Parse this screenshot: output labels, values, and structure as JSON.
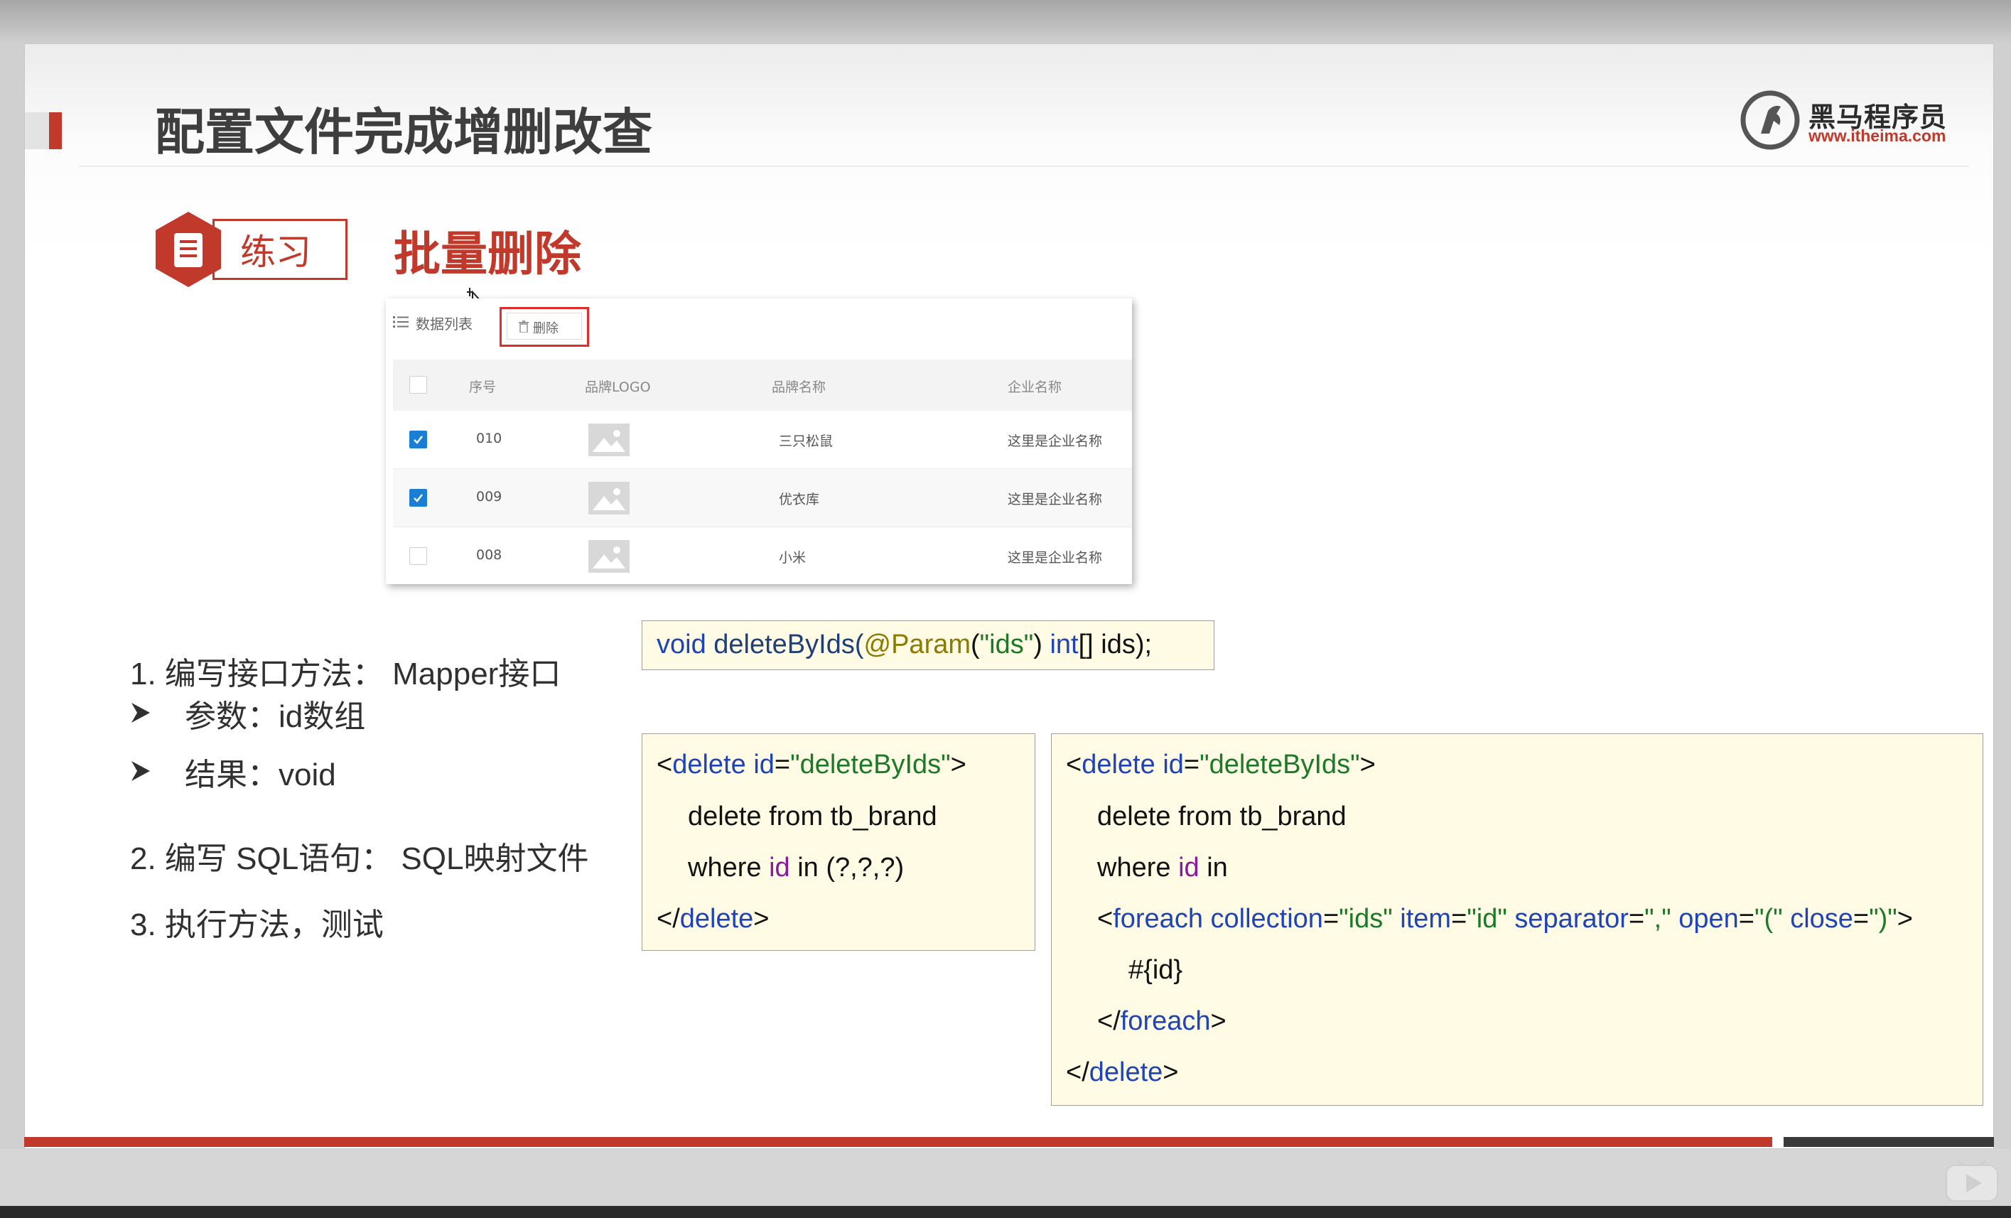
{
  "slide": {
    "title": "配置文件完成增删改查",
    "logo_text": "黑马程序员",
    "logo_url": "www.itheima.com",
    "badge_label": "练习",
    "exercise_title": "批量删除"
  },
  "panel": {
    "list_label": "数据列表",
    "delete_label": "删除",
    "columns": [
      "序号",
      "品牌LOGO",
      "品牌名称",
      "企业名称"
    ],
    "rows": [
      {
        "checked": true,
        "id": "010",
        "name": "三只松鼠",
        "company": "这里是企业名称"
      },
      {
        "checked": true,
        "id": "009",
        "name": "优衣库",
        "company": "这里是企业名称"
      },
      {
        "checked": false,
        "id": "008",
        "name": "小米",
        "company": "这里是企业名称"
      }
    ]
  },
  "steps": {
    "step1": "1.  编写接口方法：  Mapper接口",
    "param": "参数：id数组",
    "result": "结果：void",
    "step2": "2.  编写 SQL语句：  SQL映射文件",
    "step3": "3.  执行方法，测试"
  },
  "code": {
    "signature": {
      "void": "void",
      "method": " deleteByIds(",
      "ann": "@Param",
      "p1": "(",
      "str": "\"ids\"",
      "p2": ") ",
      "int": "int",
      "rest": "[] ids);"
    },
    "tag_delete": "delete",
    "attr_id": "id",
    "id_value": "\"deleteByIds\"",
    "sql_delete": "delete from tb_brand",
    "sql_where": "where ",
    "sql_id": "id",
    "sql_in_placeholders": " in (?,?,?)",
    "sql_in": " in",
    "tag_foreach": "foreach",
    "attr_collection": "collection",
    "val_ids": "\"ids\"",
    "attr_item": "item",
    "val_id": "\"id\"",
    "attr_separator": "separator",
    "val_sep": "\",\"",
    "attr_open": "open",
    "val_open": "\"(\"",
    "attr_close": "close",
    "val_close": "\")\"",
    "placeholder": "#{id}"
  },
  "colors": {
    "accent": "#c0392b",
    "keyword": "#1e44b8",
    "string": "#1a7a28",
    "annotation": "#8f7a00",
    "identifier": "#8b1a9b",
    "code_bg": "#fffbe5",
    "checkbox": "#1a7fd4"
  }
}
